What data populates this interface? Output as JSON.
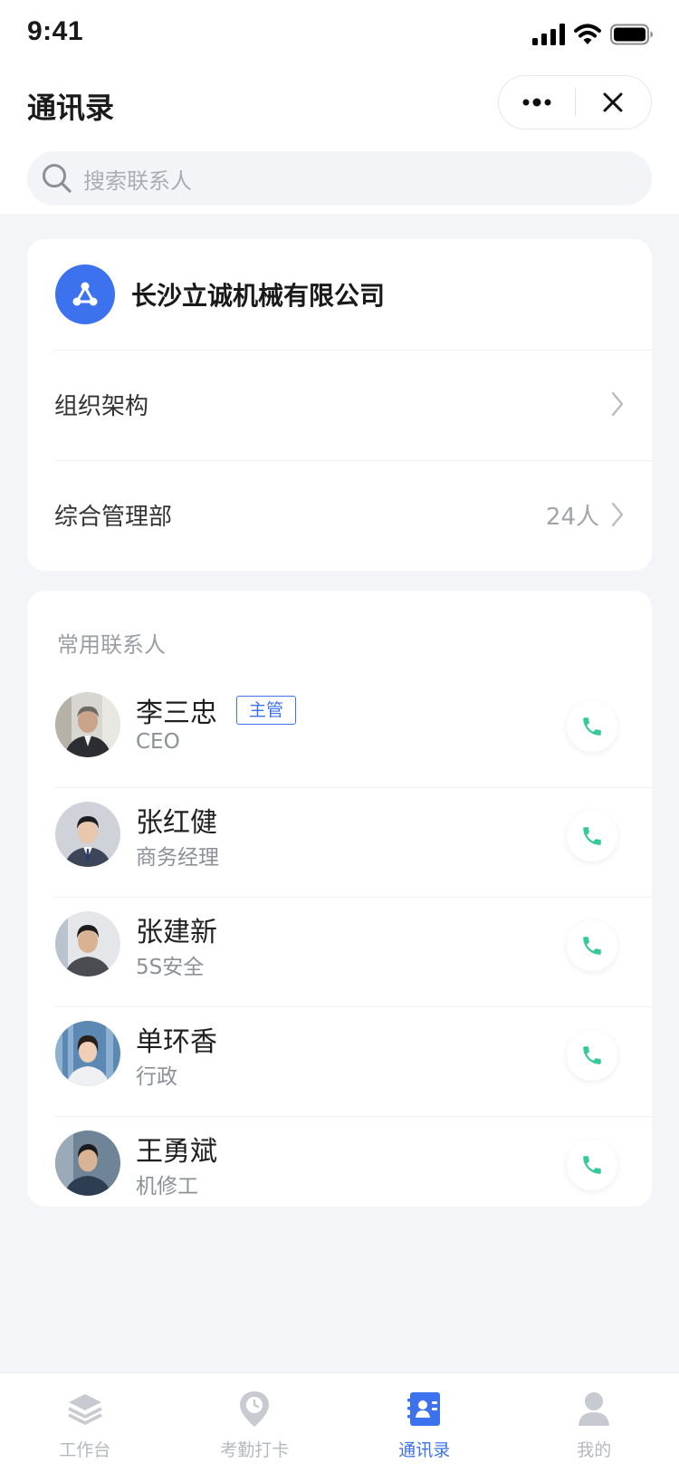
{
  "status_bar": {
    "time": "9:41"
  },
  "nav": {
    "title": "通讯录"
  },
  "search": {
    "placeholder": "搜索联系人"
  },
  "org": {
    "name": "长沙立诚机械有限公司",
    "rows": [
      {
        "label": "组织架构",
        "count": ""
      },
      {
        "label": "综合管理部",
        "count": "24人"
      }
    ]
  },
  "contacts": {
    "section_label": "常用联系人",
    "items": [
      {
        "name": "李三忠",
        "title": "CEO",
        "tag": "主管"
      },
      {
        "name": "张红健",
        "title": "商务经理",
        "tag": ""
      },
      {
        "name": "张建新",
        "title": "5S安全",
        "tag": ""
      },
      {
        "name": "单环香",
        "title": "行政",
        "tag": ""
      },
      {
        "name": "王勇斌",
        "title": "机修工",
        "tag": ""
      }
    ]
  },
  "tabbar": {
    "tabs": [
      {
        "label": "工作台",
        "icon": "layers-icon"
      },
      {
        "label": "考勤打卡",
        "icon": "location-clock-icon"
      },
      {
        "label": "通讯录",
        "icon": "contacts-book-icon",
        "active": true
      },
      {
        "label": "我的",
        "icon": "person-icon"
      }
    ]
  },
  "colors": {
    "accent": "#3d72ef",
    "call_green": "#35c99a",
    "background": "#f4f5f9"
  }
}
